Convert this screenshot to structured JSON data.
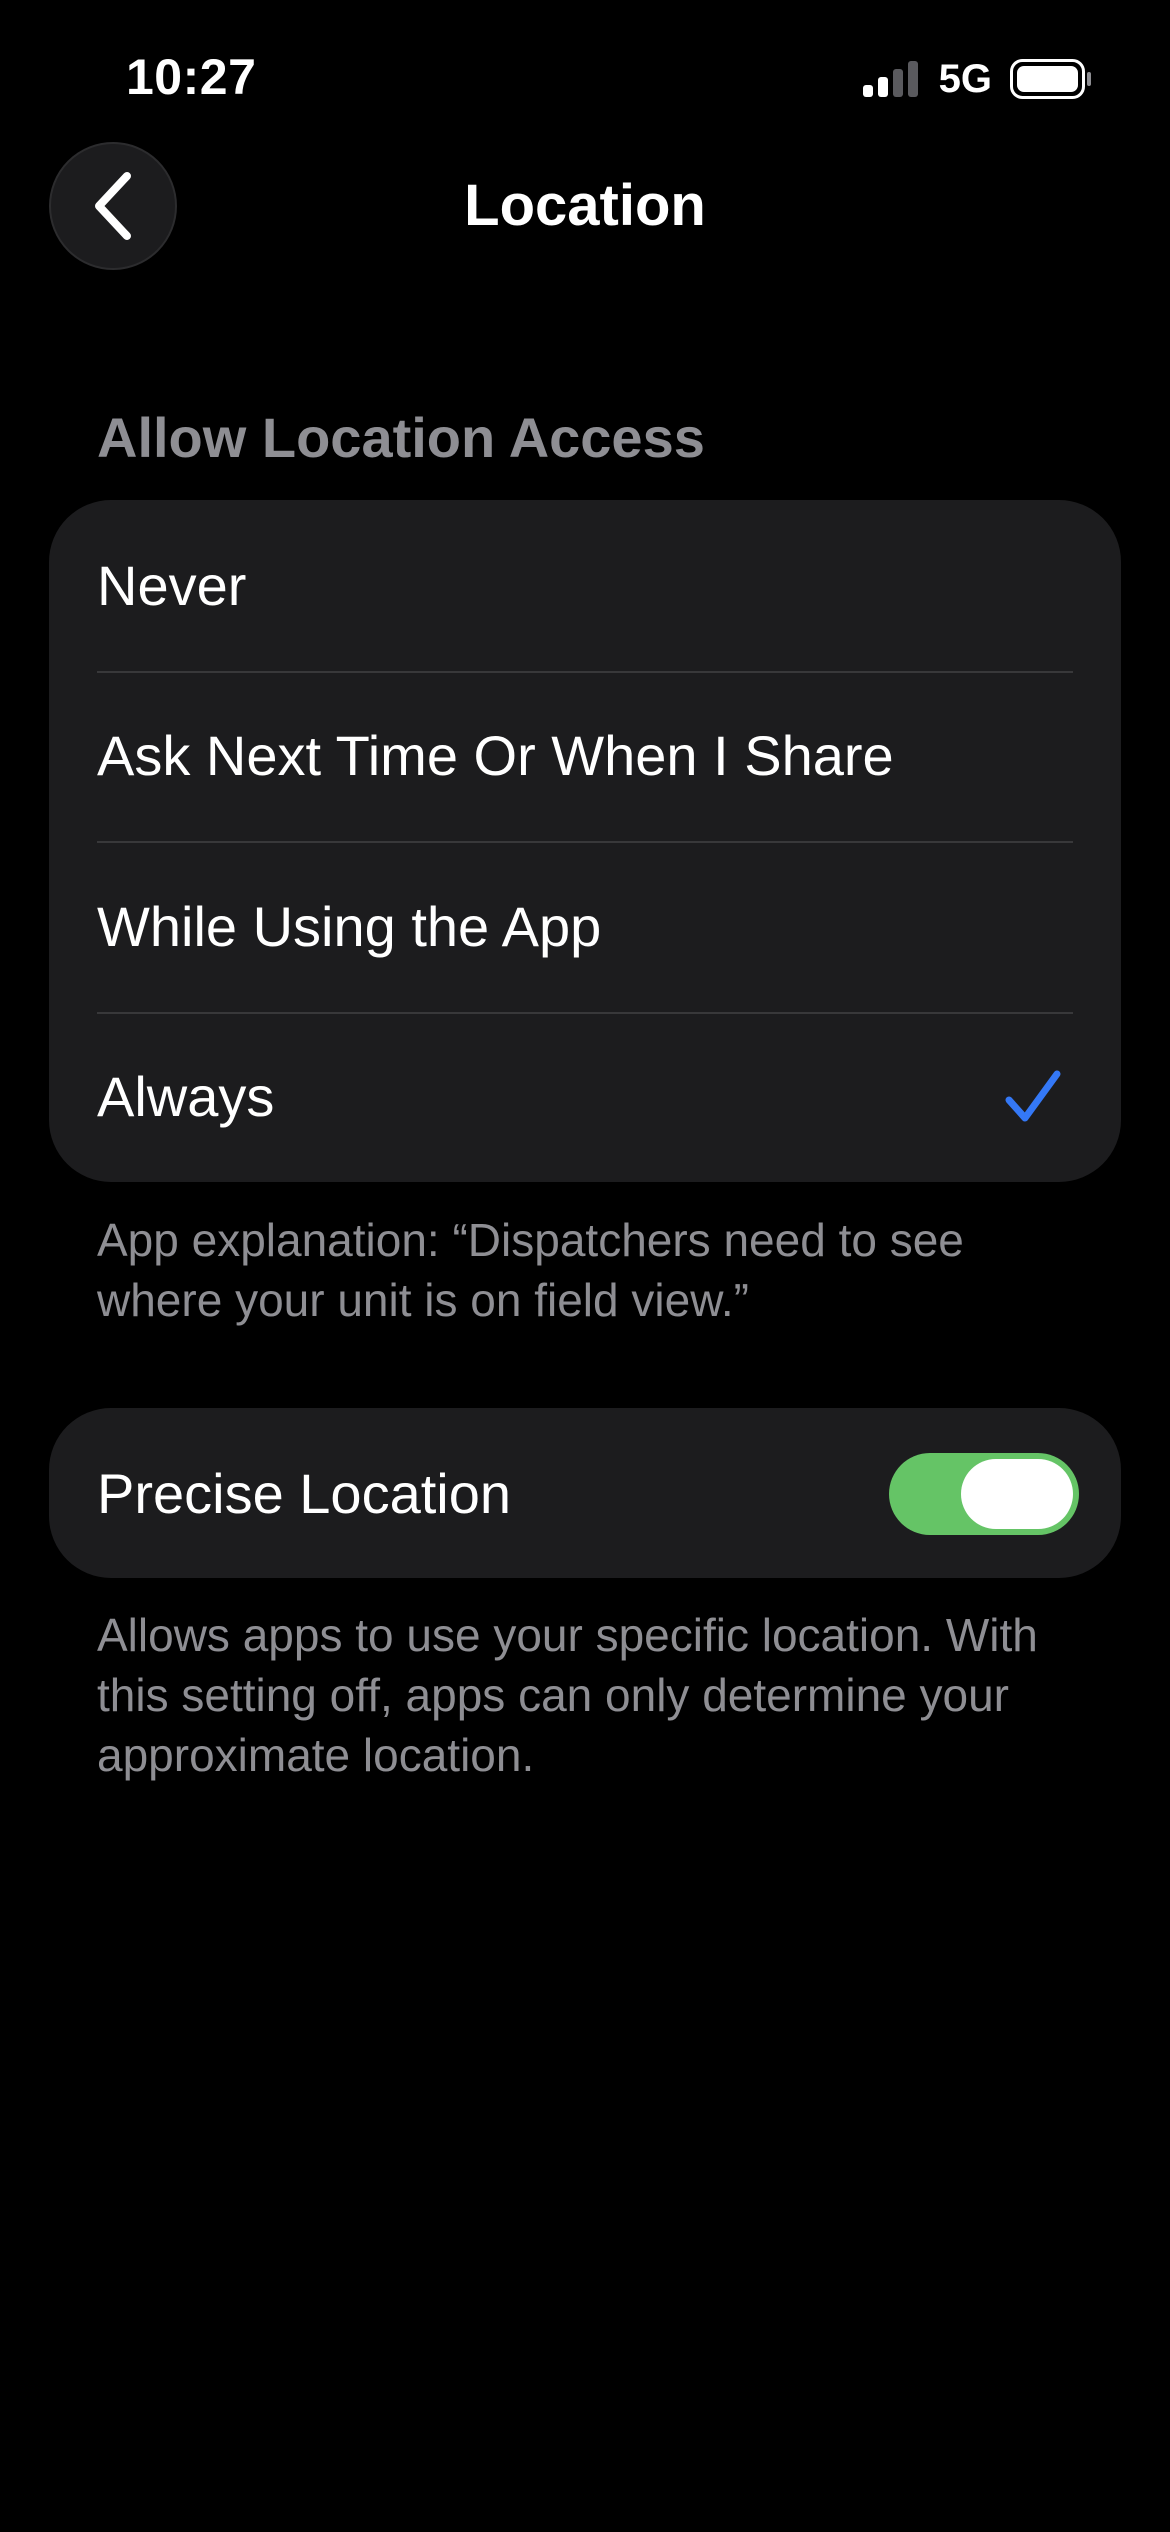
{
  "status_bar": {
    "time": "10:27",
    "network": "5G",
    "icons": [
      "signal-icon",
      "battery-icon"
    ]
  },
  "nav": {
    "title": "Location",
    "back_icon": "chevron-left-icon"
  },
  "location_access": {
    "header": "Allow Location Access",
    "options": [
      {
        "label": "Never",
        "selected": false
      },
      {
        "label": "Ask Next Time Or When I Share",
        "selected": false
      },
      {
        "label": "While Using the App",
        "selected": false
      },
      {
        "label": "Always",
        "selected": true
      }
    ],
    "explanation": "App explanation: “Dispatchers need to see where your unit is on field view.”"
  },
  "precise_location": {
    "label": "Precise Location",
    "enabled": true,
    "description": "Allows apps to use your specific location. With this setting off, apps can only determine your approximate location."
  },
  "colors": {
    "background": "#000000",
    "group_background": "#1c1c1e",
    "secondary_text": "#8e8e93",
    "accent_check": "#3478f6",
    "toggle_on": "#65c466"
  }
}
